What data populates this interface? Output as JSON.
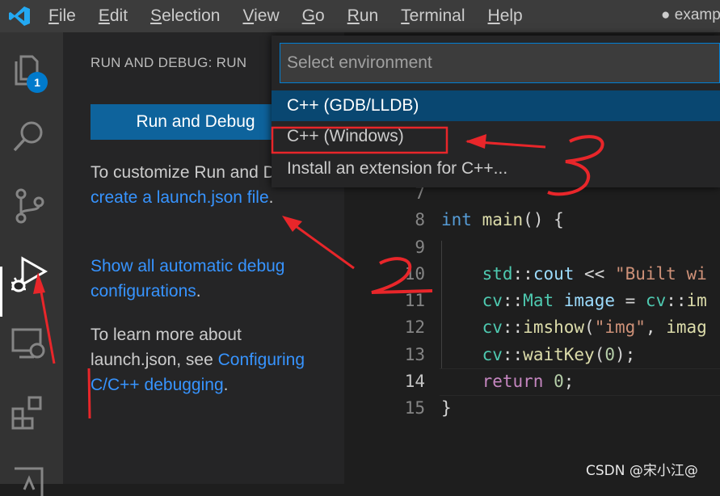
{
  "menu": {
    "items": [
      {
        "label": "File",
        "u": "F",
        "rest": "ile"
      },
      {
        "label": "Edit",
        "u": "E",
        "rest": "dit"
      },
      {
        "label": "Selection",
        "u": "S",
        "rest": "election"
      },
      {
        "label": "View",
        "u": "V",
        "rest": "iew"
      },
      {
        "label": "Go",
        "u": "G",
        "rest": "o"
      },
      {
        "label": "Run",
        "u": "R",
        "rest": "un"
      },
      {
        "label": "Terminal",
        "u": "T",
        "rest": "erminal"
      },
      {
        "label": "Help",
        "u": "H",
        "rest": "elp"
      }
    ],
    "window_title": "● examp"
  },
  "activity": {
    "explorer_badge": "1",
    "icons": [
      "files-icon",
      "search-icon",
      "source-control-icon",
      "run-debug-icon",
      "remote-explorer-icon",
      "extensions-icon",
      "testing-icon"
    ]
  },
  "sidebar": {
    "title": "RUN AND DEBUG: RUN",
    "run_button": "Run and Debug",
    "customize_pre": "To customize Run and Debug ",
    "customize_link": "create a launch.json file",
    "customize_post": ".",
    "show_link": "Show all automatic debug configurations",
    "show_post": ".",
    "learn_pre": "To learn more about launch.json, see ",
    "learn_link": "Configuring C/C++ debugging",
    "learn_post": "."
  },
  "quickpick": {
    "placeholder": "Select environment",
    "items": [
      "C++ (GDB/LLDB)",
      "C++ (Windows)",
      "Install an extension for C++..."
    ],
    "selected_index": 0
  },
  "editor": {
    "lines": [
      {
        "no": "7",
        "code": ""
      },
      {
        "no": "8",
        "code": "int main() {"
      },
      {
        "no": "9",
        "code": ""
      },
      {
        "no": "10",
        "code": "    std::cout << \"Built wi"
      },
      {
        "no": "11",
        "code": "    cv::Mat image = cv::im"
      },
      {
        "no": "12",
        "code": "    cv::imshow(\"img\", imag"
      },
      {
        "no": "13",
        "code": "    cv::waitKey(0);"
      },
      {
        "no": "14",
        "code": "    return 0;"
      },
      {
        "no": "15",
        "code": "}"
      }
    ],
    "current_line": "14"
  },
  "annotations": {
    "numbers": [
      "2",
      "3"
    ],
    "color": "#e8262a"
  },
  "watermark": "CSDN @宋小江@",
  "colors": {
    "accent": "#007acc",
    "link": "#3794ff",
    "button": "#0e639c",
    "selected": "#094771"
  }
}
